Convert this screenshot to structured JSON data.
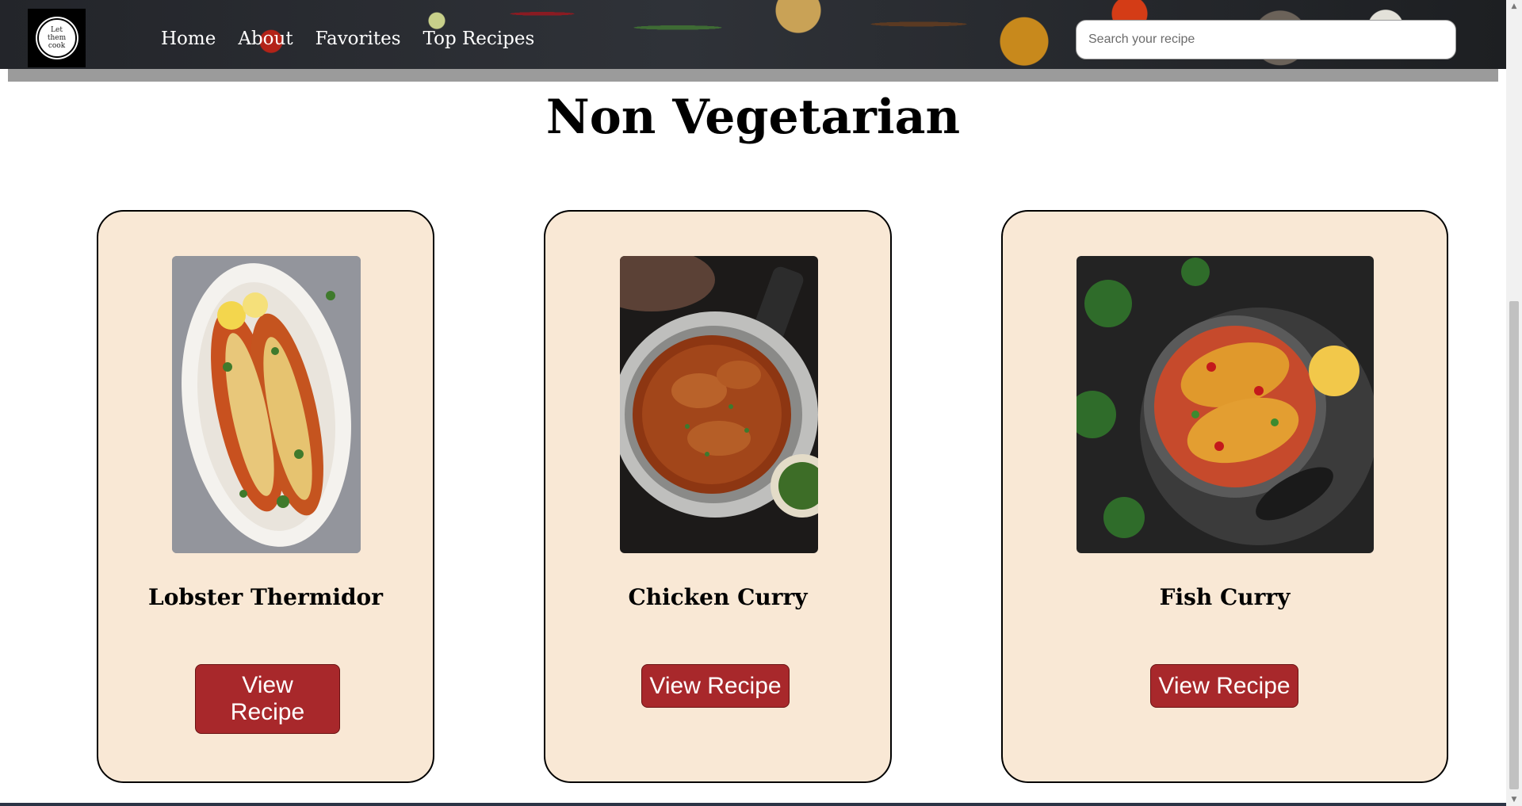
{
  "header": {
    "logo_text": "Let\nthem\ncook",
    "nav": [
      "Home",
      "About",
      "Favorites",
      "Top Recipes"
    ],
    "search_placeholder": "Search your recipe"
  },
  "main": {
    "title": "Non Vegetarian",
    "cards": [
      {
        "name": "Lobster Thermidor",
        "button": "View Recipe",
        "image_icon": "lobster-dish-image"
      },
      {
        "name": "Chicken Curry",
        "button": "View Recipe",
        "image_icon": "chicken-curry-image"
      },
      {
        "name": "Fish Curry",
        "button": "View Recipe",
        "image_icon": "fish-curry-image"
      }
    ]
  },
  "colors": {
    "card_bg": "#f9e8d5",
    "button_bg": "#a8282b",
    "header_strip": "#9b9b9b"
  }
}
